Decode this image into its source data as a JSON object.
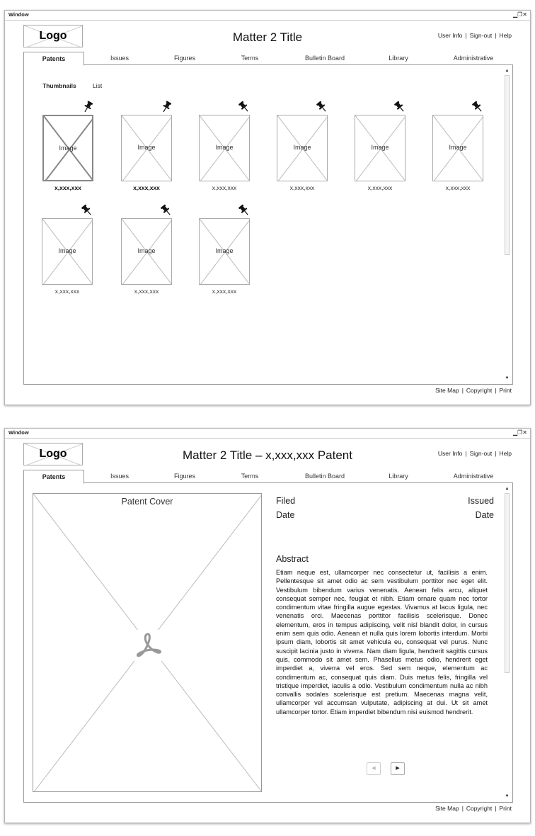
{
  "screen1": {
    "window_title": "Window",
    "logo": "Logo",
    "matter_title": "Matter 2 Title",
    "user_links": [
      "User Info",
      "Sign-out",
      "Help"
    ],
    "tabs": [
      "Patents",
      "Issues",
      "Figures",
      "Terms",
      "Bulletin Board",
      "Library",
      "Administrative"
    ],
    "active_tab": "Patents",
    "view_modes": [
      "Thumbnails",
      "List"
    ],
    "active_view": "Thumbnails",
    "thumbnails": [
      {
        "label": "Image",
        "number": "x,xxx,xxx",
        "pinned": true,
        "selected": true
      },
      {
        "label": "Image",
        "number": "x,xxx,xxx",
        "pinned": true,
        "selected": false
      },
      {
        "label": "Image",
        "number": "x,xxx,xxx",
        "pinned": false,
        "selected": false
      },
      {
        "label": "Image",
        "number": "x,xxx,xxx",
        "pinned": false,
        "selected": false
      },
      {
        "label": "Image",
        "number": "x,xxx,xxx",
        "pinned": false,
        "selected": false
      },
      {
        "label": "Image",
        "number": "x,xxx,xxx",
        "pinned": false,
        "selected": false
      },
      {
        "label": "Image",
        "number": "x,xxx,xxx",
        "pinned": false,
        "selected": false
      },
      {
        "label": "Image",
        "number": "x,xxx,xxx",
        "pinned": false,
        "selected": false
      },
      {
        "label": "Image",
        "number": "x,xxx,xxx",
        "pinned": false,
        "selected": false
      }
    ],
    "footer_links": [
      "Site Map",
      "Copyright",
      "Print"
    ]
  },
  "screen2": {
    "window_title": "Window",
    "logo": "Logo",
    "matter_title": "Matter 2 Title – x,xxx,xxx Patent",
    "user_links": [
      "User Info",
      "Sign-out",
      "Help"
    ],
    "tabs": [
      "Patents",
      "Issues",
      "Figures",
      "Terms",
      "Bulletin Board",
      "Library",
      "Administrative"
    ],
    "active_tab": "Patents",
    "cover_title": "Patent Cover",
    "filed_label": "Filed",
    "filed_date": "Date",
    "issued_label": "Issued",
    "issued_date": "Date",
    "abstract_title": "Abstract",
    "abstract_text": "Etiam neque est, ullamcorper nec consectetur ut, facilisis a enim. Pellentesque sit amet odio ac sem vestibulum porttitor nec eget elit. Vestibulum bibendum varius venenatis. Aenean felis arcu, aliquet consequat semper nec, feugiat et nibh. Etiam ornare quam nec tortor condimentum vitae fringilla augue egestas. Vivamus at lacus ligula, nec venenatis orci. Maecenas porttitor facilisis scelerisque. Donec elementum, eros in tempus adipiscing, velit nisl blandit dolor, in cursus enim sem quis odio. Aenean et nulla quis lorem lobortis interdum. Morbi ipsum diam, lobortis sit amet vehicula eu, consequat vel purus. Nunc suscipit lacinia justo in viverra. Nam diam ligula, hendrerit sagittis cursus quis, commodo sit amet sem. Phasellus metus odio, hendrerit eget imperdiet a, viverra vel eros. Sed sem neque, elementum ac condimentum ac, consequat quis diam. Duis metus felis, fringilla vel tristique imperdiet, iaculis a odio. Vestibulum condimentum nulla ac nibh convallis sodales scelerisque est pretium. Maecenas magna velit, ullamcorper vel accumsan vulputate, adipiscing at dui. Ut sit amet ullamcorper tortor. Etiam imperdiet bibendum nisi euismod hendrerit.",
    "footer_links": [
      "Site Map",
      "Copyright",
      "Print"
    ]
  },
  "icons": {
    "window_controls": "minimize-maximize-close",
    "pin": "pushpin-icon",
    "pdf": "adobe-pdf-icon",
    "prev": "triangle-left",
    "next": "triangle-right",
    "scroll_up": "triangle-up",
    "scroll_down": "triangle-down"
  },
  "colors": {
    "border": "#999999",
    "placeholder_line": "#aaaaaa",
    "selected_border": "#888888",
    "pdf_icon": "#999999"
  }
}
